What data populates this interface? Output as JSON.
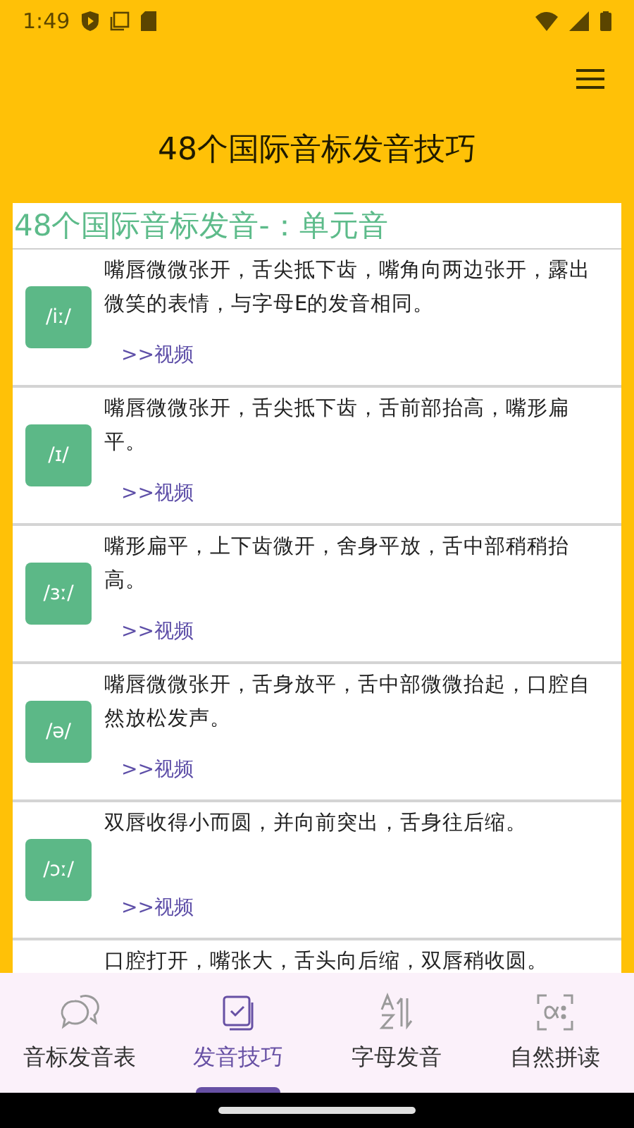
{
  "status_bar": {
    "time": "1:49"
  },
  "app_bar": {
    "title": "48个国际音标发音技巧"
  },
  "section": {
    "heading": "48个国际音标发音-：单元音",
    "items": [
      {
        "symbol": "/iː/",
        "description": "嘴唇微微张开，舌尖抵下齿，嘴角向两边张开，露出微笑的表情，与字母E的发音相同。",
        "link": ">>视频"
      },
      {
        "symbol": "/ɪ/",
        "description": "嘴唇微微张开，舌尖抵下齿，舌前部抬高，嘴形扁平。",
        "link": ">>视频"
      },
      {
        "symbol": "/ɜː/",
        "description": "嘴形扁平，上下齿微开，舍身平放，舌中部稍稍抬高。",
        "link": ">>视频"
      },
      {
        "symbol": "/ə/",
        "description": "嘴唇微微张开，舌身放平，舌中部微微抬起，口腔自然放松发声。",
        "link": ">>视频"
      },
      {
        "symbol": "/ɔː/",
        "description": "双唇收得小而圆，并向前突出，舌身往后缩。",
        "link": ">>视频"
      },
      {
        "description": "口腔打开，嘴张大，舌头向后缩，双唇稍收圆。"
      }
    ]
  },
  "bottom_nav": [
    {
      "label": "音标发音表",
      "selected": false,
      "kind": "chat"
    },
    {
      "label": "发音技巧",
      "selected": true,
      "kind": "check"
    },
    {
      "label": "字母发音",
      "selected": false,
      "kind": "sort"
    },
    {
      "label": "自然拼读",
      "selected": false,
      "kind": "alpha"
    }
  ]
}
